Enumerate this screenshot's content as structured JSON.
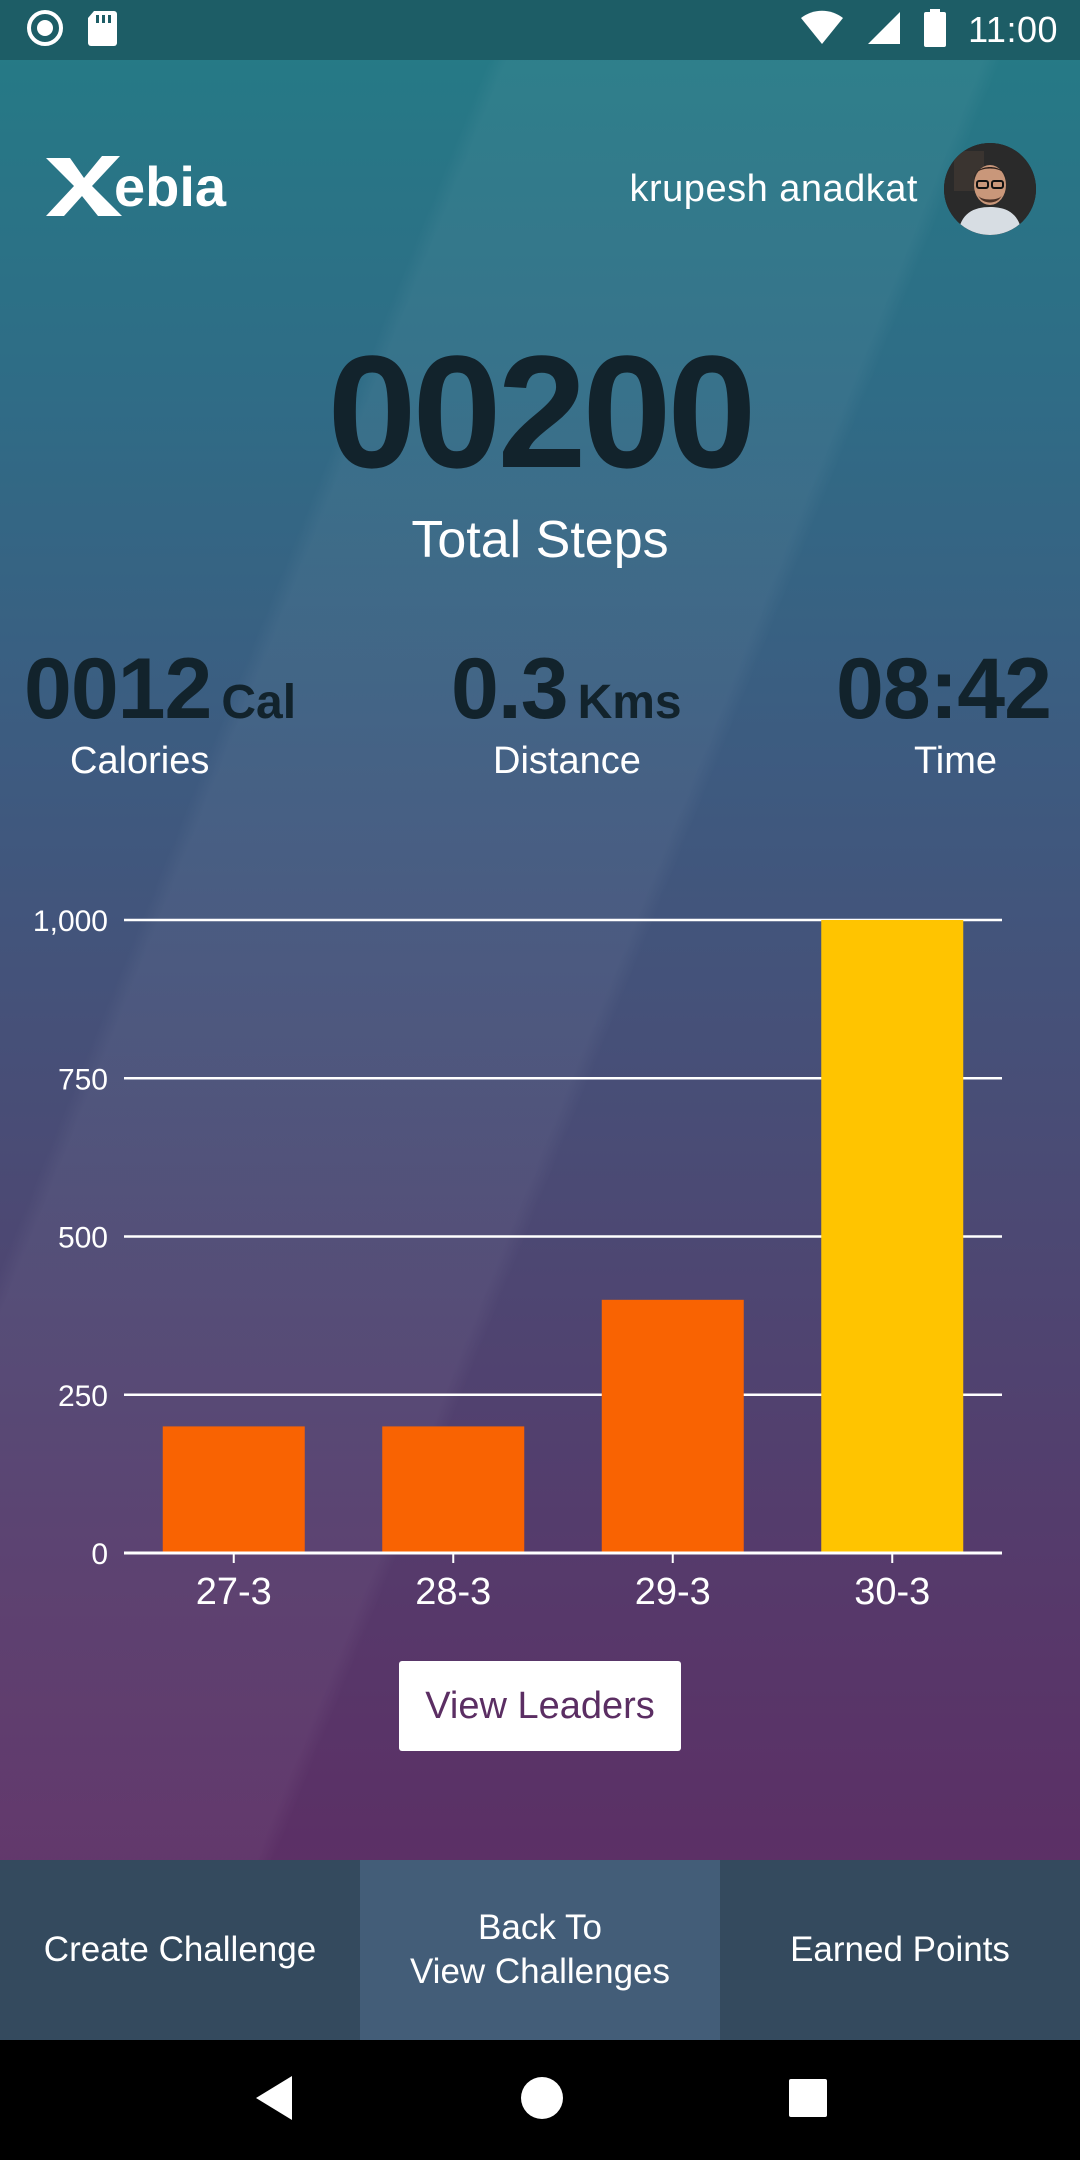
{
  "status_bar": {
    "time": "11:00"
  },
  "header": {
    "logo_text": "Xebia",
    "user_name": "krupesh anadkat"
  },
  "summary": {
    "total_steps": "00200",
    "total_steps_label": "Total Steps"
  },
  "stats": {
    "calories": {
      "value": "0012",
      "unit": "Cal",
      "label": "Calories"
    },
    "distance": {
      "value": "0.3",
      "unit": "Kms",
      "label": "Distance"
    },
    "time": {
      "value": "08:42",
      "label": "Time"
    }
  },
  "chart_data": {
    "type": "bar",
    "categories": [
      "27-3",
      "28-3",
      "29-3",
      "30-3"
    ],
    "values": [
      200,
      200,
      400,
      1000
    ],
    "ylim": [
      0,
      1000
    ],
    "yticks": [
      0,
      250,
      500,
      750,
      1000
    ],
    "ytick_labels": [
      "0",
      "250",
      "500",
      "750",
      "1,000"
    ],
    "grid": true,
    "bar_colors": [
      "#f96302",
      "#f96302",
      "#f96302",
      "#ffc400"
    ]
  },
  "actions": {
    "view_leaders": "View Leaders"
  },
  "tabs": [
    {
      "label": "Create Challenge",
      "active": false
    },
    {
      "label": "Back To\nView Challenges",
      "active": true
    },
    {
      "label": "Earned Points",
      "active": false
    }
  ],
  "colors": {
    "accent_orange": "#f96302",
    "accent_yellow": "#ffc400",
    "tab_bg": "#344a5e",
    "tab_active_bg": "#435d78"
  }
}
